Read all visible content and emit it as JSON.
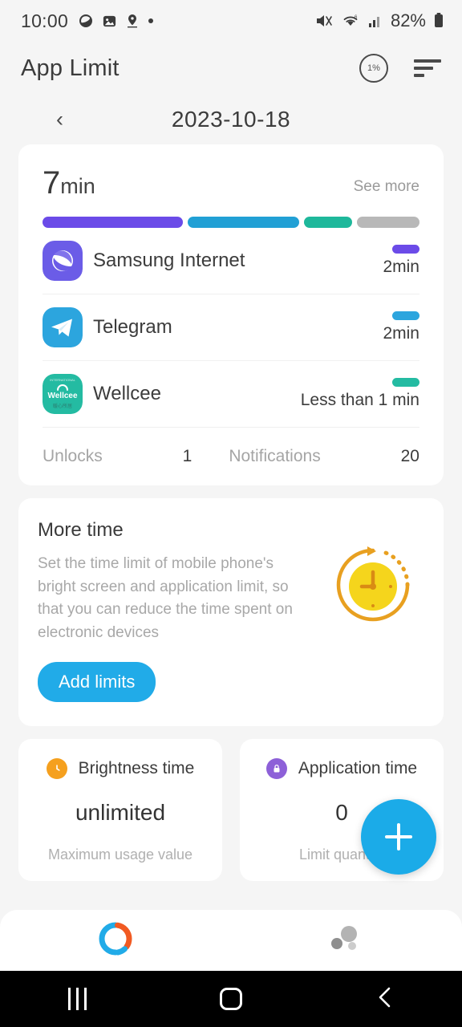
{
  "status_bar": {
    "time": "10:00",
    "battery_percent": "82%",
    "left_icons": [
      "browser-icon",
      "image-icon",
      "location-icon",
      "dot-icon"
    ],
    "right_icons": [
      "mute-icon",
      "wifi-icon",
      "signal-icon",
      "battery-icon"
    ]
  },
  "app_bar": {
    "title": "App Limit",
    "percent_badge": "1%",
    "filter_icon": "filter-icon"
  },
  "date_nav": {
    "prev_label": "‹",
    "date": "2023-10-18"
  },
  "usage": {
    "total": "7",
    "total_unit": "min",
    "see_more": "See more",
    "segments": [
      {
        "color": "#6B4BE8",
        "flex": 38
      },
      {
        "color": "#21A0D5",
        "flex": 30
      },
      {
        "color": "#1EB89B",
        "flex": 13
      },
      {
        "color": "#B8B8B8",
        "flex": 17
      }
    ],
    "apps": [
      {
        "name": "Samsung Internet",
        "time": "2min",
        "color": "#6B4BE8",
        "icon": "samsung-internet-icon"
      },
      {
        "name": "Telegram",
        "time": "2min",
        "color": "#2CA5DE",
        "icon": "telegram-icon"
      },
      {
        "name": "Wellcee",
        "time": "Less than 1 min",
        "color": "#24BBA2",
        "icon": "wellcee-icon"
      }
    ],
    "stats": {
      "unlocks_label": "Unlocks",
      "unlocks_value": "1",
      "notifications_label": "Notifications",
      "notifications_value": "20"
    }
  },
  "more_time": {
    "title": "More time",
    "description": "Set the time limit of mobile phone's bright screen and application limit, so that you can reduce the time spent on electronic devices",
    "button_label": "Add limits",
    "illustration": "clock-arrow-illustration"
  },
  "mini_cards": [
    {
      "title": "Brightness time",
      "value": "unlimited",
      "subtitle": "Maximum usage value",
      "badge_color": "#F5A01E",
      "icon": "clock-icon"
    },
    {
      "title": "Application time",
      "value": "0",
      "subtitle": "Limit quantity",
      "badge_color": "#8D60D8",
      "icon": "lock-icon"
    }
  ],
  "fab": {
    "label": "+",
    "color": "#1BABE8",
    "icon": "plus-icon"
  },
  "bottom_nav": [
    {
      "icon": "usage-donut-icon",
      "active": true
    },
    {
      "icon": "bubbles-more-icon",
      "active": false
    }
  ],
  "android_nav": {
    "recents": "recents-icon",
    "home": "home-icon",
    "back": "back-icon"
  },
  "wellcee_icon": {
    "top_text": "INTERNATIONAL",
    "logo_text": "Wellcee",
    "bottom_text": "暖心所居"
  }
}
